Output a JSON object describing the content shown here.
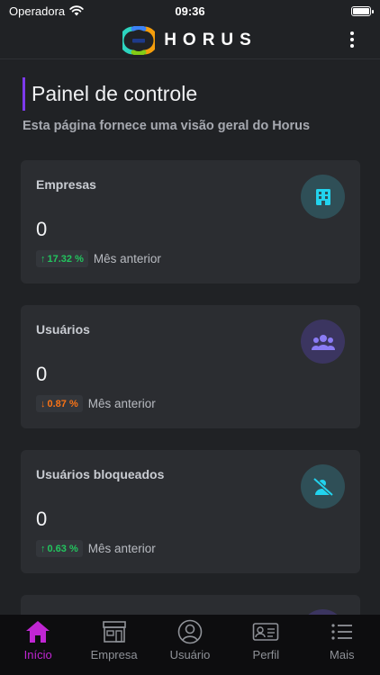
{
  "status_bar": {
    "carrier": "Operadora",
    "time": "09:36"
  },
  "header": {
    "brand_name": "HORUS"
  },
  "page": {
    "title": "Painel de controle",
    "subtitle": "Esta página fornece uma visão geral do Horus"
  },
  "cards": [
    {
      "label": "Empresas",
      "value": "0",
      "trend_direction": "up",
      "trend_arrow": "↑",
      "trend_value": "17.32 %",
      "trend_text": "Mês anterior",
      "trend_color": "#22c55e",
      "icon": "building-icon",
      "icon_bg": "#2f4f57",
      "icon_color": "#22d3ee"
    },
    {
      "label": "Usuários",
      "value": "0",
      "trend_direction": "down",
      "trend_arrow": "↓",
      "trend_value": "0.87 %",
      "trend_text": "Mês anterior",
      "trend_color": "#f97316",
      "icon": "users-icon",
      "icon_bg": "#3b3560",
      "icon_color": "#8b7cf6"
    },
    {
      "label": "Usuários bloqueados",
      "value": "0",
      "trend_direction": "up",
      "trend_arrow": "↑",
      "trend_value": "0.63 %",
      "trend_text": "Mês anterior",
      "trend_color": "#22c55e",
      "icon": "blocked-user-icon",
      "icon_bg": "#2f4f57",
      "icon_color": "#22d3ee"
    }
  ],
  "tabs": [
    {
      "label": "Início",
      "icon": "home-icon",
      "active": true
    },
    {
      "label": "Empresa",
      "icon": "store-icon",
      "active": false
    },
    {
      "label": "Usuário",
      "icon": "user-circle-icon",
      "active": false
    },
    {
      "label": "Perfil",
      "icon": "id-card-icon",
      "active": false
    },
    {
      "label": "Mais",
      "icon": "list-icon",
      "active": false
    }
  ],
  "colors": {
    "accent": "#7c3aed",
    "tab_active": "#c026d3",
    "background": "#202225",
    "card": "#2b2d31"
  }
}
